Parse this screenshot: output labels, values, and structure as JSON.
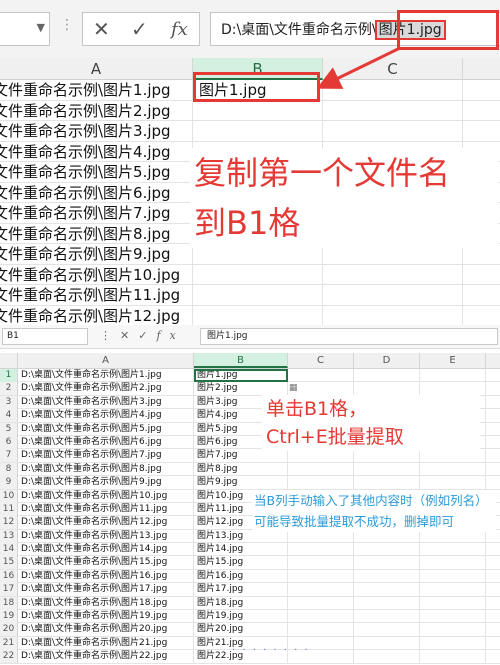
{
  "top": {
    "name_box": "",
    "formula_value_prefix": "D:\\桌面\\文件重命名示例\\",
    "formula_value_highlight": "图片1.jpg",
    "col_headers": [
      "A",
      "B",
      "C"
    ],
    "rows": [
      {
        "a": "文件重命名示例\\图片1.jpg",
        "b": "图片1.jpg"
      },
      {
        "a": "文件重命名示例\\图片2.jpg",
        "b": ""
      },
      {
        "a": "文件重命名示例\\图片3.jpg",
        "b": ""
      },
      {
        "a": "文件重命名示例\\图片4.jpg",
        "b": ""
      },
      {
        "a": "文件重命名示例\\图片5.jpg",
        "b": ""
      },
      {
        "a": "文件重命名示例\\图片6.jpg",
        "b": ""
      },
      {
        "a": "文件重命名示例\\图片7.jpg",
        "b": ""
      },
      {
        "a": "文件重命名示例\\图片8.jpg",
        "b": ""
      },
      {
        "a": "文件重命名示例\\图片9.jpg",
        "b": ""
      },
      {
        "a": "文件重命名示例\\图片10.jpg",
        "b": ""
      },
      {
        "a": "文件重命名示例\\图片11.jpg",
        "b": ""
      },
      {
        "a": "文件重命名示例\\图片12.jpg",
        "b": ""
      }
    ],
    "annotation_line1": "复制第一个文件名",
    "annotation_line2": "到B1格"
  },
  "bottom": {
    "name_box": "B1",
    "formula_value": "图片1.jpg",
    "col_headers": [
      "A",
      "B",
      "C",
      "D",
      "E"
    ],
    "rows": [
      {
        "n": "1",
        "a": "D:\\桌面\\文件重命名示例\\图片1.jpg",
        "b": "图片1.jpg"
      },
      {
        "n": "2",
        "a": "D:\\桌面\\文件重命名示例\\图片2.jpg",
        "b": "图片2.jpg"
      },
      {
        "n": "3",
        "a": "D:\\桌面\\文件重命名示例\\图片3.jpg",
        "b": "图片3.jpg"
      },
      {
        "n": "4",
        "a": "D:\\桌面\\文件重命名示例\\图片4.jpg",
        "b": "图片4.jpg"
      },
      {
        "n": "5",
        "a": "D:\\桌面\\文件重命名示例\\图片5.jpg",
        "b": "图片5.jpg"
      },
      {
        "n": "6",
        "a": "D:\\桌面\\文件重命名示例\\图片6.jpg",
        "b": "图片6.jpg"
      },
      {
        "n": "7",
        "a": "D:\\桌面\\文件重命名示例\\图片7.jpg",
        "b": "图片7.jpg"
      },
      {
        "n": "8",
        "a": "D:\\桌面\\文件重命名示例\\图片8.jpg",
        "b": "图片8.jpg"
      },
      {
        "n": "9",
        "a": "D:\\桌面\\文件重命名示例\\图片9.jpg",
        "b": "图片9.jpg"
      },
      {
        "n": "10",
        "a": "D:\\桌面\\文件重命名示例\\图片10.jpg",
        "b": "图片10.jpg"
      },
      {
        "n": "11",
        "a": "D:\\桌面\\文件重命名示例\\图片11.jpg",
        "b": "图片11.jpg"
      },
      {
        "n": "12",
        "a": "D:\\桌面\\文件重命名示例\\图片12.jpg",
        "b": "图片12.jpg"
      },
      {
        "n": "13",
        "a": "D:\\桌面\\文件重命名示例\\图片13.jpg",
        "b": "图片13.jpg"
      },
      {
        "n": "14",
        "a": "D:\\桌面\\文件重命名示例\\图片14.jpg",
        "b": "图片14.jpg"
      },
      {
        "n": "15",
        "a": "D:\\桌面\\文件重命名示例\\图片15.jpg",
        "b": "图片15.jpg"
      },
      {
        "n": "16",
        "a": "D:\\桌面\\文件重命名示例\\图片16.jpg",
        "b": "图片16.jpg"
      },
      {
        "n": "17",
        "a": "D:\\桌面\\文件重命名示例\\图片17.jpg",
        "b": "图片17.jpg"
      },
      {
        "n": "18",
        "a": "D:\\桌面\\文件重命名示例\\图片18.jpg",
        "b": "图片18.jpg"
      },
      {
        "n": "19",
        "a": "D:\\桌面\\文件重命名示例\\图片19.jpg",
        "b": "图片19.jpg"
      },
      {
        "n": "20",
        "a": "D:\\桌面\\文件重命名示例\\图片20.jpg",
        "b": "图片20.jpg"
      },
      {
        "n": "21",
        "a": "D:\\桌面\\文件重命名示例\\图片21.jpg",
        "b": "图片21.jpg"
      },
      {
        "n": "22",
        "a": "D:\\桌面\\文件重命名示例\\图片22.jpg",
        "b": "图片22.jpg"
      }
    ],
    "annotation_red_line1": "单击B1格，",
    "annotation_red_line2": "Ctrl+E批量提取",
    "annotation_blue": "当B列手动输入了其他内容时（例如列名）可能导致批量提取不成功，删掉即可"
  },
  "colors": {
    "annotation_red": "#e53935",
    "annotation_blue": "#2b9bd8",
    "excel_green": "#217346"
  },
  "icons": {
    "cancel": "close-icon",
    "confirm": "check-icon",
    "function": "fx-icon"
  }
}
